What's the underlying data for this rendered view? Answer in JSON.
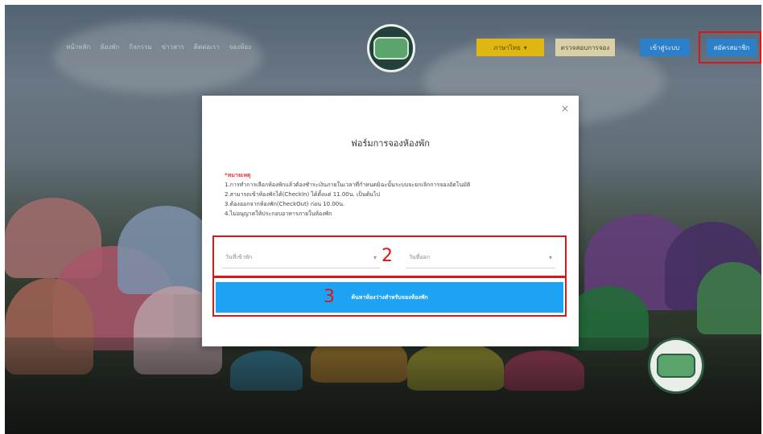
{
  "header": {
    "nav_items": [
      "หน้าหลัก",
      "ห้องพัก",
      "กิจกรรม",
      "ข่าวสาร",
      "ติดต่อเรา",
      "จองห้อง"
    ],
    "lang_button": "ภาษาไทย",
    "lang_caret": "▾",
    "contact_button": "ตรวจสอบการจอง",
    "login_button": "เข้าสู่ระบบ",
    "register_button": "สมัครสมาชิก"
  },
  "modal": {
    "close": "×",
    "title": "ฟอร์มการจองห้องพัก",
    "notes_head": "*หมายเหตุ",
    "notes": [
      "1.การทำการเลือกห้องพักแล้วต้องชำระเงินภายในเวลาที่กำหนดมิฉะนั้นระบบจะยกเลิกการจองอัตโนมัติ",
      "2.สามารถเข้าห้องพักได้(CheckIn) ได้ตั้งแต่ 11.00น. เป็นต้นไป",
      "3.ต้องออกจากห้องพัก(CheckOut) ก่อน 10.00น.",
      "4.ไม่อนุญาตให้ประกอบอาหารภายในห้องพัก"
    ],
    "checkin_placeholder": "วันที่เข้าพัก",
    "checkout_placeholder": "วันที่ออก",
    "search_button": "ค้นหาห้องว่างสำหรับจองห้องพัก"
  },
  "annotations": {
    "label_2": "2",
    "label_3": "3"
  },
  "colors": {
    "primary_button": "#1ea2f3",
    "annotation_red": "#e01414",
    "lang_yellow": "#e0b612"
  }
}
